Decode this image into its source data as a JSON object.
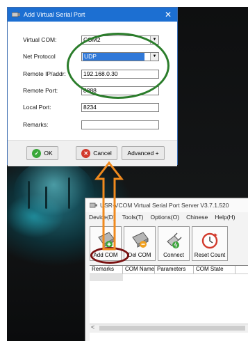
{
  "dialog": {
    "title": "Add Virtual Serial Port",
    "close": "✕",
    "fields": {
      "virtual_com_label": "Virtual COM:",
      "virtual_com_value": "COM2",
      "net_protocol_label": "Net Protocol",
      "net_protocol_value": "UDP",
      "remote_ip_label": "Remote IP/addr:",
      "remote_ip_value": "192.168.0.30",
      "remote_port_label": "Remote Port:",
      "remote_port_value": "8888",
      "local_port_label": "Local Port:",
      "local_port_value": "8234",
      "remarks_label": "Remarks:",
      "remarks_value": ""
    },
    "buttons": {
      "ok": "OK",
      "cancel": "Cancel",
      "advanced": "Advanced +"
    }
  },
  "usr_window": {
    "title": "USR-VCOM Virtual Serial Port Server V3.7.1.520",
    "menu": [
      "Device(D)",
      "Tools(T)",
      "Options(O)",
      "Chinese",
      "Help(H)"
    ],
    "toolbar": [
      "Add COM",
      "Del COM",
      "Connect",
      "Reset Count"
    ],
    "columns": [
      "Remarks",
      "COM Name",
      "Parameters",
      "COM State"
    ],
    "scroll_left": "<"
  },
  "colors": {
    "title_blue": "#1c6fd2",
    "highlight_green": "#2b7d2b",
    "highlight_red": "#7a1212",
    "arrow_orange": "#f08a1e"
  }
}
